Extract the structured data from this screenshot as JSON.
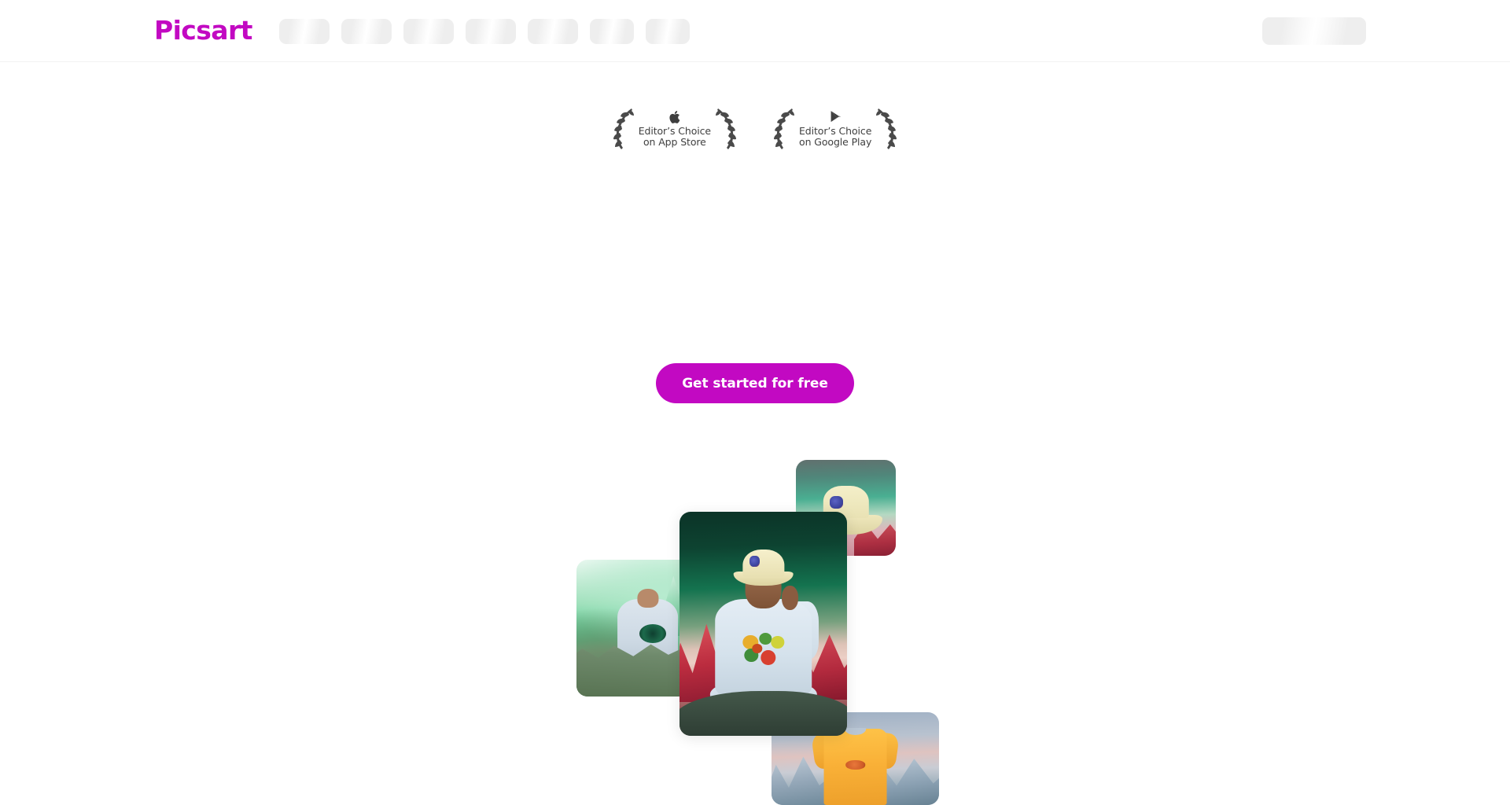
{
  "brand": {
    "logo_text": "Picsart",
    "accent_color": "#c209c2"
  },
  "header": {
    "nav_skeleton_widths": [
      64,
      64,
      64,
      64,
      64,
      56,
      56
    ],
    "account_button_skeleton": "loading"
  },
  "badges": [
    {
      "icon": "apple-logo-icon",
      "line1": "Editor’s Choice",
      "line2": "on App Store"
    },
    {
      "icon": "google-play-icon",
      "line1": "Editor’s Choice",
      "line2": "on Google Play"
    }
  ],
  "cta": {
    "label": "Get started for free",
    "color": "#c209c2",
    "text_color": "#ffffff"
  },
  "collage": {
    "cards": [
      {
        "name": "card-left",
        "alt": "Person in light grey hoodie with green graphic standing on green mountain landscape"
      },
      {
        "name": "card-top-right",
        "alt": "Cream bucket hat with colorful patch on teal and pink mountain background"
      },
      {
        "name": "card-main",
        "alt": "Person seated cross-legged wearing cream bucket hat and light blue hoodie with fruit graphic on red and green mountain landscape"
      },
      {
        "name": "card-bottom-right",
        "alt": "Yellow t-shirt with small orange graphic on misty blue mountain background"
      }
    ]
  }
}
